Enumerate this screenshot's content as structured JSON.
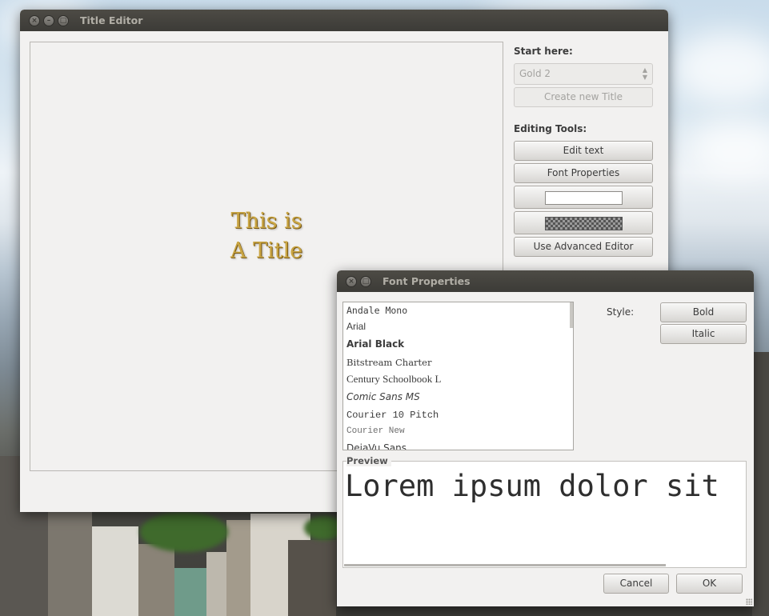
{
  "title_editor": {
    "window_title": "Title Editor",
    "canvas_title_line1": "This is",
    "canvas_title_line2": "A Title",
    "start_here_label": "Start here:",
    "template_select_value": "Gold 2",
    "create_title_label": "Create new Title",
    "editing_tools_label": "Editing Tools:",
    "edit_text_label": "Edit text",
    "font_properties_label": "Font Properties",
    "use_advanced_editor_label": "Use Advanced Editor",
    "title_color": "#c9a543"
  },
  "font_properties": {
    "window_title": "Font Properties",
    "fonts": [
      {
        "name": "Andale Mono"
      },
      {
        "name": "Arial"
      },
      {
        "name": "Arial Black"
      },
      {
        "name": "Bitstream Charter"
      },
      {
        "name": "Century Schoolbook L"
      },
      {
        "name": "Comic Sans MS"
      },
      {
        "name": "Courier 10 Pitch"
      },
      {
        "name": "Courier New"
      },
      {
        "name": "DejaVu Sans"
      }
    ],
    "style_label": "Style:",
    "bold_label": "Bold",
    "italic_label": "Italic",
    "preview_label": "Preview",
    "preview_text": "Lorem ipsum dolor sit",
    "cancel_label": "Cancel",
    "ok_label": "OK"
  }
}
